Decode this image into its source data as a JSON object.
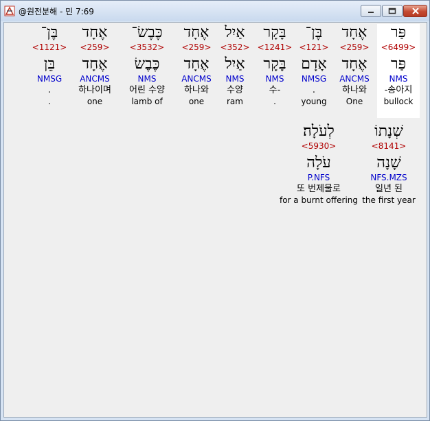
{
  "window": {
    "title": "@원전분해 - 민 7:69"
  },
  "row1": [
    {
      "orig": "פַּר",
      "strong": "<6499>",
      "lemma": "פַּר",
      "parse": "NMS",
      "kor": "-송아지",
      "eng": "bullock",
      "highlight": true
    },
    {
      "orig": "אֶחָד",
      "strong": "<259>",
      "lemma": "אֶחָד",
      "parse": "ANCMS",
      "kor": "하나와",
      "eng": "One"
    },
    {
      "orig": "בֶּן־",
      "strong": "<121>",
      "lemma": "אָדָם",
      "parse": "NMSG",
      "kor": ".",
      "eng": "young"
    },
    {
      "orig": "בָּקָר",
      "strong": "<1241>",
      "lemma": "בָּקָר",
      "parse": "NMS",
      "kor": "수-",
      "eng": "."
    },
    {
      "orig": "אַיִל",
      "strong": "<352>",
      "lemma": "אַיִל",
      "parse": "NMS",
      "kor": "수양",
      "eng": "ram"
    },
    {
      "orig": "אֶחָד",
      "strong": "<259>",
      "lemma": "אֶחָד",
      "parse": "ANCMS",
      "kor": "하나와",
      "eng": "one"
    },
    {
      "orig": "כֶּבֶשׂ־",
      "strong": "<3532>",
      "lemma": "כֶּבֶשׂ",
      "parse": "NMS",
      "kor": "어린 수양",
      "eng": "lamb of"
    },
    {
      "orig": "אֶחָד",
      "strong": "<259>",
      "lemma": "אֶחָד",
      "parse": "ANCMS",
      "kor": "하나이며",
      "eng": "one"
    },
    {
      "orig": "בֶּן־",
      "strong": "<1121>",
      "lemma": "בֵּן",
      "parse": "NMSG",
      "kor": ".",
      "eng": "."
    }
  ],
  "row2": [
    {
      "orig": "שְׁנָתוֹ",
      "strong": "<8141>",
      "lemma": "שָׁנָה",
      "parse": "NFS.MZS",
      "kor": "일년 된",
      "eng": "the first year"
    },
    {
      "orig": "לְעֹלָה׃",
      "strong": "<5930>",
      "lemma": "עֹלָה",
      "parse": "P.NFS",
      "kor": "또 번제물로",
      "eng": "for a burnt offering"
    }
  ]
}
